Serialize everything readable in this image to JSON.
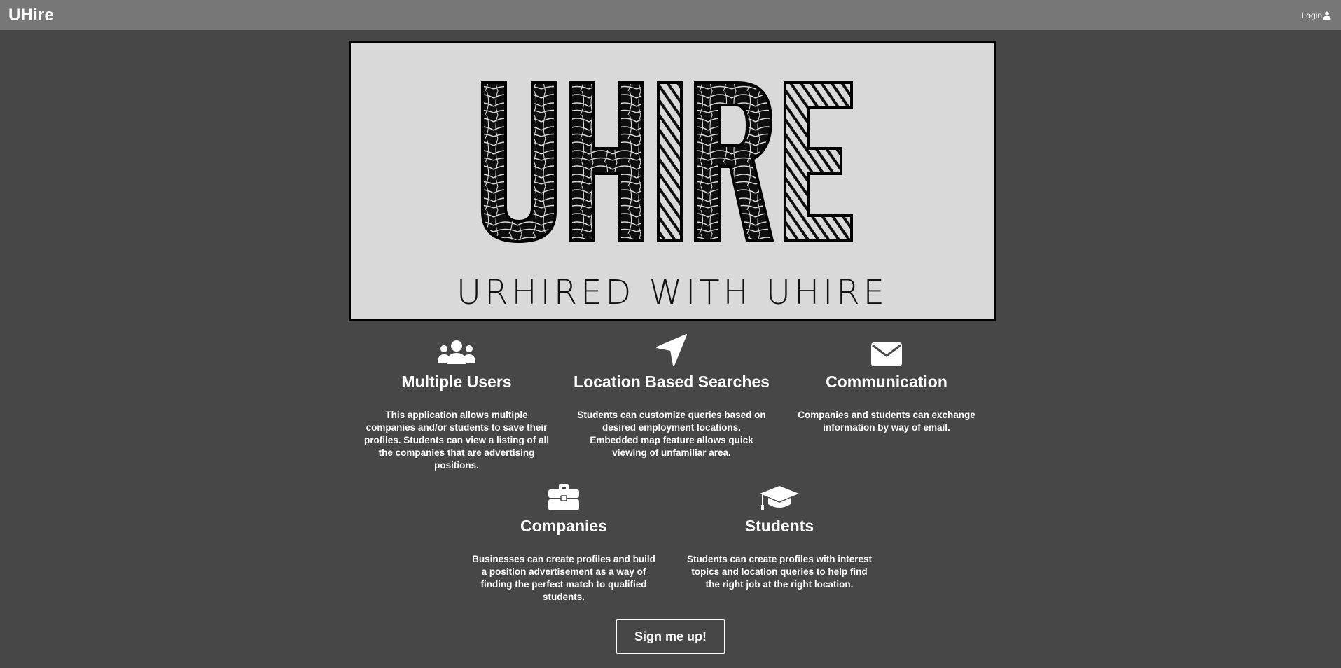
{
  "navbar": {
    "brand": "UHire",
    "login_label": "Login",
    "login_icon": "user-icon"
  },
  "hero": {
    "logo_text": "UHIRE",
    "tagline": "URHIRED WITH UHIRE"
  },
  "features": [
    {
      "icon": "users-icon",
      "title": "Multiple Users",
      "description": "This application allows multiple companies and/or students to save their profiles. Students can view a listing of all the companies that are advertising positions."
    },
    {
      "icon": "location-arrow-icon",
      "title": "Location Based Searches",
      "description": "Students can customize queries based on desired employment locations. Embedded map feature allows quick viewing of unfamiliar area."
    },
    {
      "icon": "envelope-icon",
      "title": "Communication",
      "description": "Companies and students can exchange information by way of email."
    },
    {
      "icon": "briefcase-icon",
      "title": "Companies",
      "description": "Businesses can create profiles and build a position advertisement as a way of finding the perfect match to qualified students."
    },
    {
      "icon": "graduation-cap-icon",
      "title": "Students",
      "description": "Students can create profiles with interest topics and location queries to help find the right job at the right location."
    }
  ],
  "signup": {
    "label": "Sign me up!"
  },
  "colors": {
    "background": "#474747",
    "navbar": "#777777",
    "hero_background": "#d9d9d9",
    "text": "#ffffff"
  }
}
